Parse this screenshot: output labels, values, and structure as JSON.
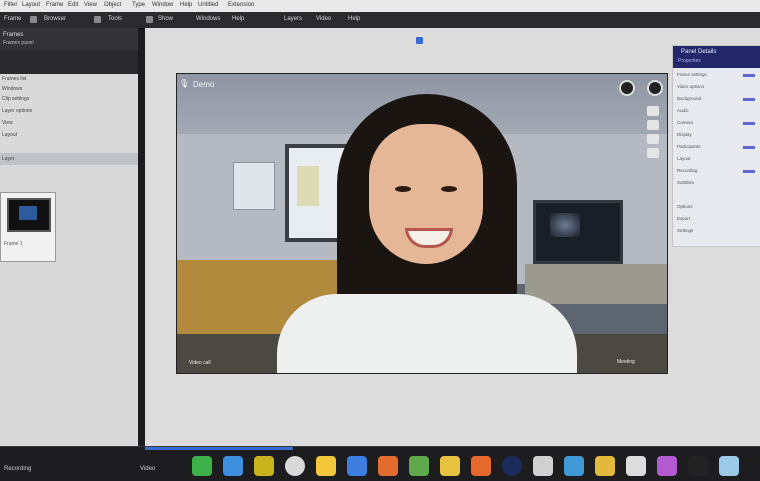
{
  "menubar": {
    "items": [
      "Filter",
      "Layout",
      "Frame",
      "Edit",
      "View",
      "Object",
      "Type",
      "Window",
      "Help",
      "Untitled",
      "Extension"
    ]
  },
  "toolbar": {
    "items": [
      "Frame",
      "Browser",
      "Tools",
      "Show",
      "Windows",
      "Help",
      "Layers",
      "Video",
      "Help"
    ]
  },
  "left_panel": {
    "title": "Frames",
    "subtitle": "Frames panel",
    "rows": [
      "Frames list",
      "Windows",
      "Clip settings",
      "Layer options",
      "View",
      "Layout"
    ],
    "selected_row": "Layer",
    "thumbnail_caption": "Frame 1"
  },
  "video": {
    "participant_name": "Demo",
    "bottom_left": "Video call",
    "bottom_right": "Meeting"
  },
  "right_panel": {
    "title": "Panel Details",
    "subtitle": "Properties",
    "rows": [
      "Frame settings",
      "Video options",
      "Background",
      "Audio",
      "Camera",
      "Display",
      "Participants",
      "Layout",
      "Recording",
      "Subtitles",
      "Options",
      "Export",
      "Settings"
    ]
  },
  "dock": {
    "left_label": "Recording",
    "mid_label": "Video",
    "icons": [
      {
        "name": "messages-icon",
        "color": "#3cb14a"
      },
      {
        "name": "finder-icon",
        "color": "#3d8fe0"
      },
      {
        "name": "app-p-icon",
        "color": "#c8b51e"
      },
      {
        "name": "chrome-icon",
        "color": "#d8d8d8"
      },
      {
        "name": "notes-icon",
        "color": "#f2c73a"
      },
      {
        "name": "safari-icon",
        "color": "#3b7de0"
      },
      {
        "name": "mail-icon",
        "color": "#e36b2e"
      },
      {
        "name": "maps-icon",
        "color": "#5fa84b"
      },
      {
        "name": "photos-icon",
        "color": "#e6c240"
      },
      {
        "name": "keynote-icon",
        "color": "#e5682d"
      },
      {
        "name": "music-icon",
        "color": "#1b2b5c"
      },
      {
        "name": "calendar-icon",
        "color": "#d0d0d0"
      },
      {
        "name": "preview-icon",
        "color": "#3f9bd8"
      },
      {
        "name": "terminal-icon",
        "color": "#e2b93a"
      },
      {
        "name": "settings-icon",
        "color": "#dcdcdc"
      },
      {
        "name": "podcasts-icon",
        "color": "#b45ad0"
      },
      {
        "name": "stocks-icon",
        "color": "#222222"
      },
      {
        "name": "trash-icon",
        "color": "#9bc9e6"
      }
    ]
  }
}
